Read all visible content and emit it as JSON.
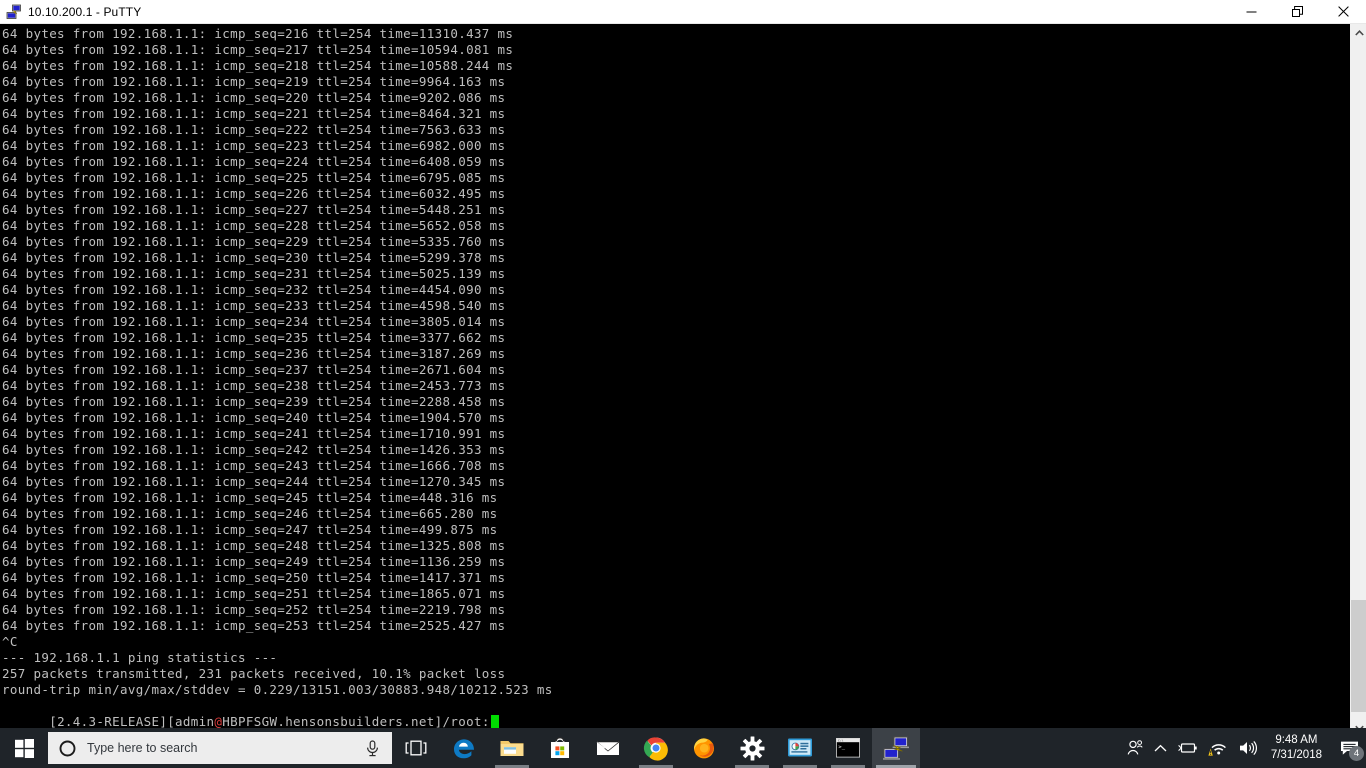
{
  "window": {
    "title": "10.10.200.1 - PuTTY",
    "icon": "putty-icon",
    "minimize_label": "Minimize",
    "restore_label": "Restore",
    "close_label": "Close"
  },
  "terminal": {
    "foreground_color": "#bfbfbf",
    "background_color": "#000000",
    "cursor_color": "#00dd00",
    "at_color": "#dd3c3c",
    "lines": [
      "64 bytes from 192.168.1.1: icmp_seq=216 ttl=254 time=11310.437 ms",
      "64 bytes from 192.168.1.1: icmp_seq=217 ttl=254 time=10594.081 ms",
      "64 bytes from 192.168.1.1: icmp_seq=218 ttl=254 time=10588.244 ms",
      "64 bytes from 192.168.1.1: icmp_seq=219 ttl=254 time=9964.163 ms",
      "64 bytes from 192.168.1.1: icmp_seq=220 ttl=254 time=9202.086 ms",
      "64 bytes from 192.168.1.1: icmp_seq=221 ttl=254 time=8464.321 ms",
      "64 bytes from 192.168.1.1: icmp_seq=222 ttl=254 time=7563.633 ms",
      "64 bytes from 192.168.1.1: icmp_seq=223 ttl=254 time=6982.000 ms",
      "64 bytes from 192.168.1.1: icmp_seq=224 ttl=254 time=6408.059 ms",
      "64 bytes from 192.168.1.1: icmp_seq=225 ttl=254 time=6795.085 ms",
      "64 bytes from 192.168.1.1: icmp_seq=226 ttl=254 time=6032.495 ms",
      "64 bytes from 192.168.1.1: icmp_seq=227 ttl=254 time=5448.251 ms",
      "64 bytes from 192.168.1.1: icmp_seq=228 ttl=254 time=5652.058 ms",
      "64 bytes from 192.168.1.1: icmp_seq=229 ttl=254 time=5335.760 ms",
      "64 bytes from 192.168.1.1: icmp_seq=230 ttl=254 time=5299.378 ms",
      "64 bytes from 192.168.1.1: icmp_seq=231 ttl=254 time=5025.139 ms",
      "64 bytes from 192.168.1.1: icmp_seq=232 ttl=254 time=4454.090 ms",
      "64 bytes from 192.168.1.1: icmp_seq=233 ttl=254 time=4598.540 ms",
      "64 bytes from 192.168.1.1: icmp_seq=234 ttl=254 time=3805.014 ms",
      "64 bytes from 192.168.1.1: icmp_seq=235 ttl=254 time=3377.662 ms",
      "64 bytes from 192.168.1.1: icmp_seq=236 ttl=254 time=3187.269 ms",
      "64 bytes from 192.168.1.1: icmp_seq=237 ttl=254 time=2671.604 ms",
      "64 bytes from 192.168.1.1: icmp_seq=238 ttl=254 time=2453.773 ms",
      "64 bytes from 192.168.1.1: icmp_seq=239 ttl=254 time=2288.458 ms",
      "64 bytes from 192.168.1.1: icmp_seq=240 ttl=254 time=1904.570 ms",
      "64 bytes from 192.168.1.1: icmp_seq=241 ttl=254 time=1710.991 ms",
      "64 bytes from 192.168.1.1: icmp_seq=242 ttl=254 time=1426.353 ms",
      "64 bytes from 192.168.1.1: icmp_seq=243 ttl=254 time=1666.708 ms",
      "64 bytes from 192.168.1.1: icmp_seq=244 ttl=254 time=1270.345 ms",
      "64 bytes from 192.168.1.1: icmp_seq=245 ttl=254 time=448.316 ms",
      "64 bytes from 192.168.1.1: icmp_seq=246 ttl=254 time=665.280 ms",
      "64 bytes from 192.168.1.1: icmp_seq=247 ttl=254 time=499.875 ms",
      "64 bytes from 192.168.1.1: icmp_seq=248 ttl=254 time=1325.808 ms",
      "64 bytes from 192.168.1.1: icmp_seq=249 ttl=254 time=1136.259 ms",
      "64 bytes from 192.168.1.1: icmp_seq=250 ttl=254 time=1417.371 ms",
      "64 bytes from 192.168.1.1: icmp_seq=251 ttl=254 time=1865.071 ms",
      "64 bytes from 192.168.1.1: icmp_seq=252 ttl=254 time=2219.798 ms",
      "64 bytes from 192.168.1.1: icmp_seq=253 ttl=254 time=2525.427 ms",
      "^C",
      "--- 192.168.1.1 ping statistics ---",
      "257 packets transmitted, 231 packets received, 10.1% packet loss",
      "round-trip min/avg/max/stddev = 0.229/13151.003/30883.948/10212.523 ms"
    ],
    "prompt": {
      "prefix": "[2.4.3-RELEASE][admin",
      "at": "@",
      "suffix": "HBPFSGW.hensonsbuilders.net]/root:"
    }
  },
  "scrollbar": {
    "up_arrow": "chevron-up-icon",
    "down_arrow": "chevron-down-icon"
  },
  "taskbar": {
    "start_label": "Start",
    "search": {
      "placeholder": "Type here to search",
      "cortana_icon": "cortana-icon",
      "mic_icon": "microphone-icon"
    },
    "taskview_label": "Task View",
    "apps": [
      {
        "name": "microsoft-edge",
        "label": "Microsoft Edge",
        "state": "pinned"
      },
      {
        "name": "file-explorer",
        "label": "File Explorer",
        "state": "open"
      },
      {
        "name": "microsoft-store",
        "label": "Microsoft Store",
        "state": "pinned"
      },
      {
        "name": "mail",
        "label": "Mail",
        "state": "pinned"
      },
      {
        "name": "google-chrome",
        "label": "Google Chrome",
        "state": "open"
      },
      {
        "name": "mozilla-firefox",
        "label": "Mozilla Firefox",
        "state": "pinned"
      },
      {
        "name": "settings",
        "label": "Settings",
        "state": "open"
      },
      {
        "name": "remote-desktop",
        "label": "Remote Desktop",
        "state": "open"
      },
      {
        "name": "command-prompt",
        "label": "Command Prompt",
        "state": "open"
      },
      {
        "name": "putty",
        "label": "PuTTY",
        "state": "active"
      }
    ],
    "tray": {
      "people_icon": "people-icon",
      "show_hidden_icon": "chevron-up-icon",
      "battery_icon": "battery-icon",
      "network_icon": "wifi-warning-icon",
      "volume_icon": "speaker-icon",
      "time": "9:48 AM",
      "date": "7/31/2018",
      "action_center_icon": "action-center-icon",
      "notification_count": "4"
    }
  }
}
